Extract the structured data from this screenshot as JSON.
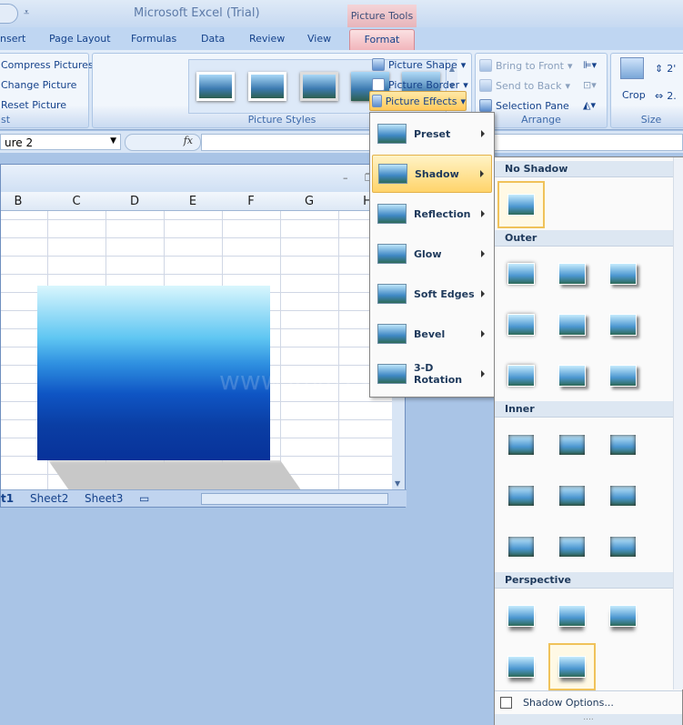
{
  "window": {
    "title": "Microsoft Excel (Trial)",
    "context_tab_group": "Picture Tools"
  },
  "tabs": [
    "nsert",
    "Page Layout",
    "Formulas",
    "Data",
    "Review",
    "View",
    "Format"
  ],
  "ribbon": {
    "adjust": {
      "items": [
        "Compress Pictures",
        "Change Picture",
        "Reset Picture"
      ],
      "label": "st"
    },
    "picture_styles": {
      "label": "Picture Styles",
      "buttons": [
        "Picture Shape",
        "Picture Border",
        "Picture Effects"
      ]
    },
    "arrange": {
      "label": "Arrange",
      "items": [
        "Bring to Front",
        "Send to Back",
        "Selection Pane"
      ]
    },
    "size": {
      "label": "Size",
      "crop": "Crop",
      "height": "2'",
      "width": "2."
    }
  },
  "formula_bar": {
    "name_box": "ure 2",
    "fx": "fx",
    "value": ""
  },
  "workbook": {
    "columns": [
      "B",
      "C",
      "D",
      "E",
      "F",
      "G",
      "H"
    ],
    "sheets": [
      "t1",
      "Sheet2",
      "Sheet3"
    ],
    "watermark": "www.java2s.com"
  },
  "effects_menu": {
    "items": [
      {
        "label": "Preset",
        "icon": "preset-icon"
      },
      {
        "label": "Shadow",
        "icon": "shadow-icon",
        "selected": true
      },
      {
        "label": "Reflection",
        "icon": "reflection-icon"
      },
      {
        "label": "Glow",
        "icon": "glow-icon"
      },
      {
        "label": "Soft Edges",
        "icon": "soft-edges-icon"
      },
      {
        "label": "Bevel",
        "icon": "bevel-icon"
      },
      {
        "label": "3-D Rotation",
        "icon": "3d-rotation-icon"
      }
    ]
  },
  "shadow_gallery": {
    "sections": [
      {
        "title": "No Shadow",
        "count": 1,
        "selected": [
          0
        ]
      },
      {
        "title": "Outer",
        "count": 9
      },
      {
        "title": "Inner",
        "count": 9
      },
      {
        "title": "Perspective",
        "count": 5,
        "selected": [
          4
        ]
      }
    ],
    "options_label": "Shadow Options..."
  }
}
